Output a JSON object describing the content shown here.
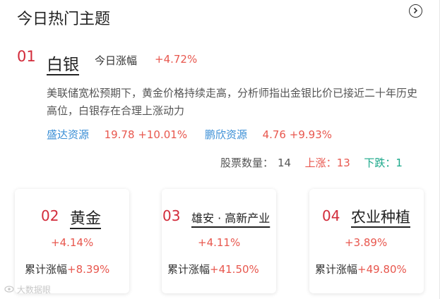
{
  "header": {
    "title": "今日热门主题"
  },
  "featured": {
    "rank": "01",
    "name": "白银",
    "today_label": "今日涨幅",
    "today_value": "+4.72%",
    "description": "美联储宽松预期下，黄金价格持续走高，分析师指出金银比价已接近二十年历史高位，白银存在合理上涨动力",
    "stocks": [
      {
        "name": "盛达资源",
        "price": "19.78",
        "change": "+10.01%"
      },
      {
        "name": "鹏欣资源",
        "price": "4.76",
        "change": "+9.93%"
      }
    ],
    "stats": {
      "count_label": "股票数量：",
      "count": "14",
      "up_label": "上涨：",
      "up": "13",
      "down_label": "下跌：",
      "down": "1"
    }
  },
  "cards": [
    {
      "rank": "02",
      "name": "黄金",
      "today": "+4.14%",
      "cum_label": "累计涨幅",
      "cum_value": "+8.39%"
    },
    {
      "rank": "03",
      "name": "雄安 · 高新产业",
      "today": "+4.11%",
      "cum_label": "累计涨幅",
      "cum_value": "+41.50%"
    },
    {
      "rank": "04",
      "name": "农业种植",
      "today": "+3.89%",
      "cum_label": "累计涨幅",
      "cum_value": "+49.80%"
    }
  ],
  "watermark": "大数据眼",
  "icons": {
    "more": "chevron-right-circle-icon"
  },
  "colors": {
    "rank": "#d22b3a",
    "up": "#e8574e",
    "down": "#1aa88a",
    "stock_link": "#3b8fd6"
  }
}
